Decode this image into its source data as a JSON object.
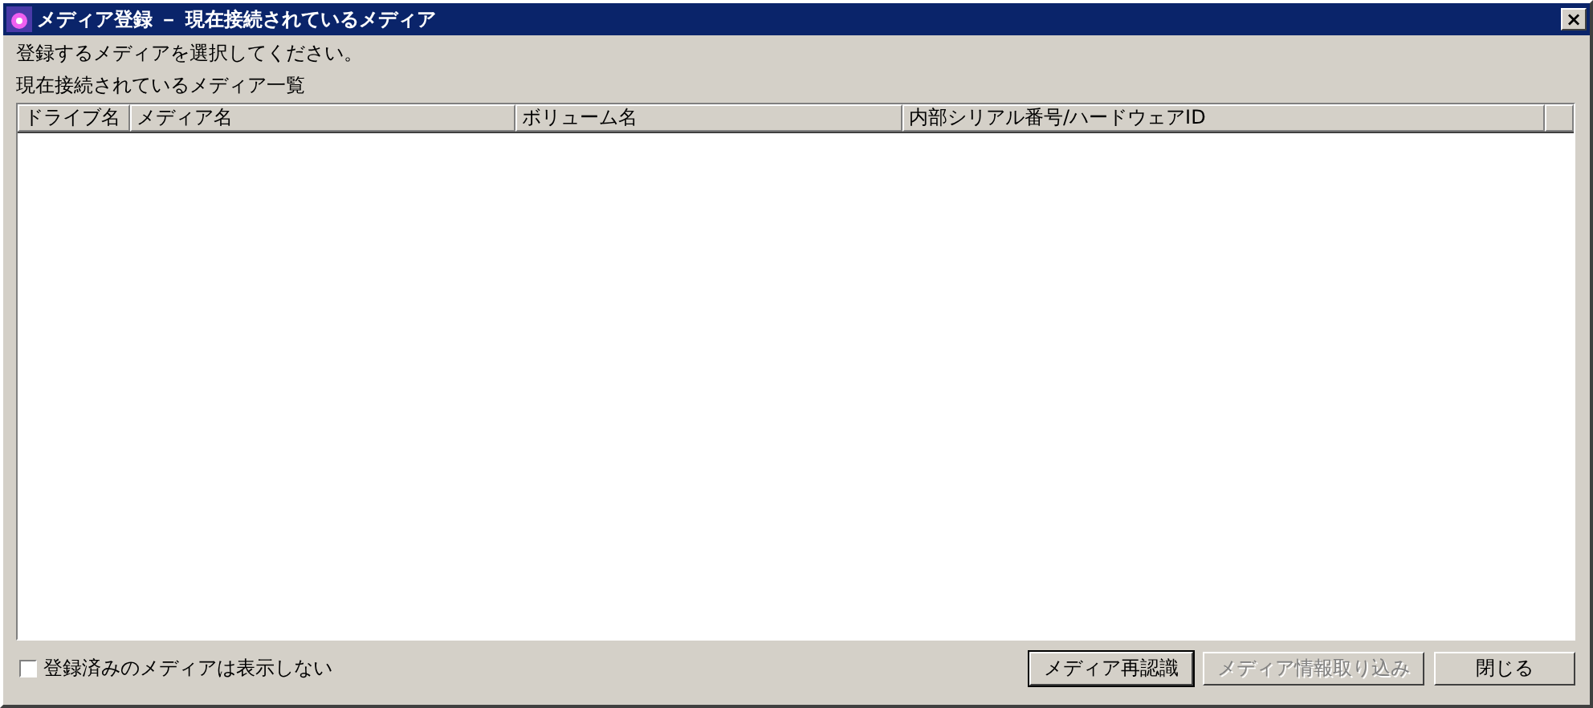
{
  "window": {
    "title": "メディア登録 － 現在接続されているメディア",
    "close": "×"
  },
  "instruction": "登録するメディアを選択してください。",
  "list_label": "現在接続されているメディア一覧",
  "table": {
    "columns": [
      "ドライブ名",
      "メディア名",
      "ボリューム名",
      "内部シリアル番号/ハードウェアID"
    ]
  },
  "hide_registered": {
    "label": "登録済みのメディアは表示しない",
    "checked": false
  },
  "buttons": [
    {
      "label": "メディア再認識",
      "disabled": false,
      "default": true
    },
    {
      "label": "メディア情報取り込み",
      "disabled": true,
      "default": false
    },
    {
      "label": "閉じる",
      "disabled": false,
      "default": false
    }
  ]
}
